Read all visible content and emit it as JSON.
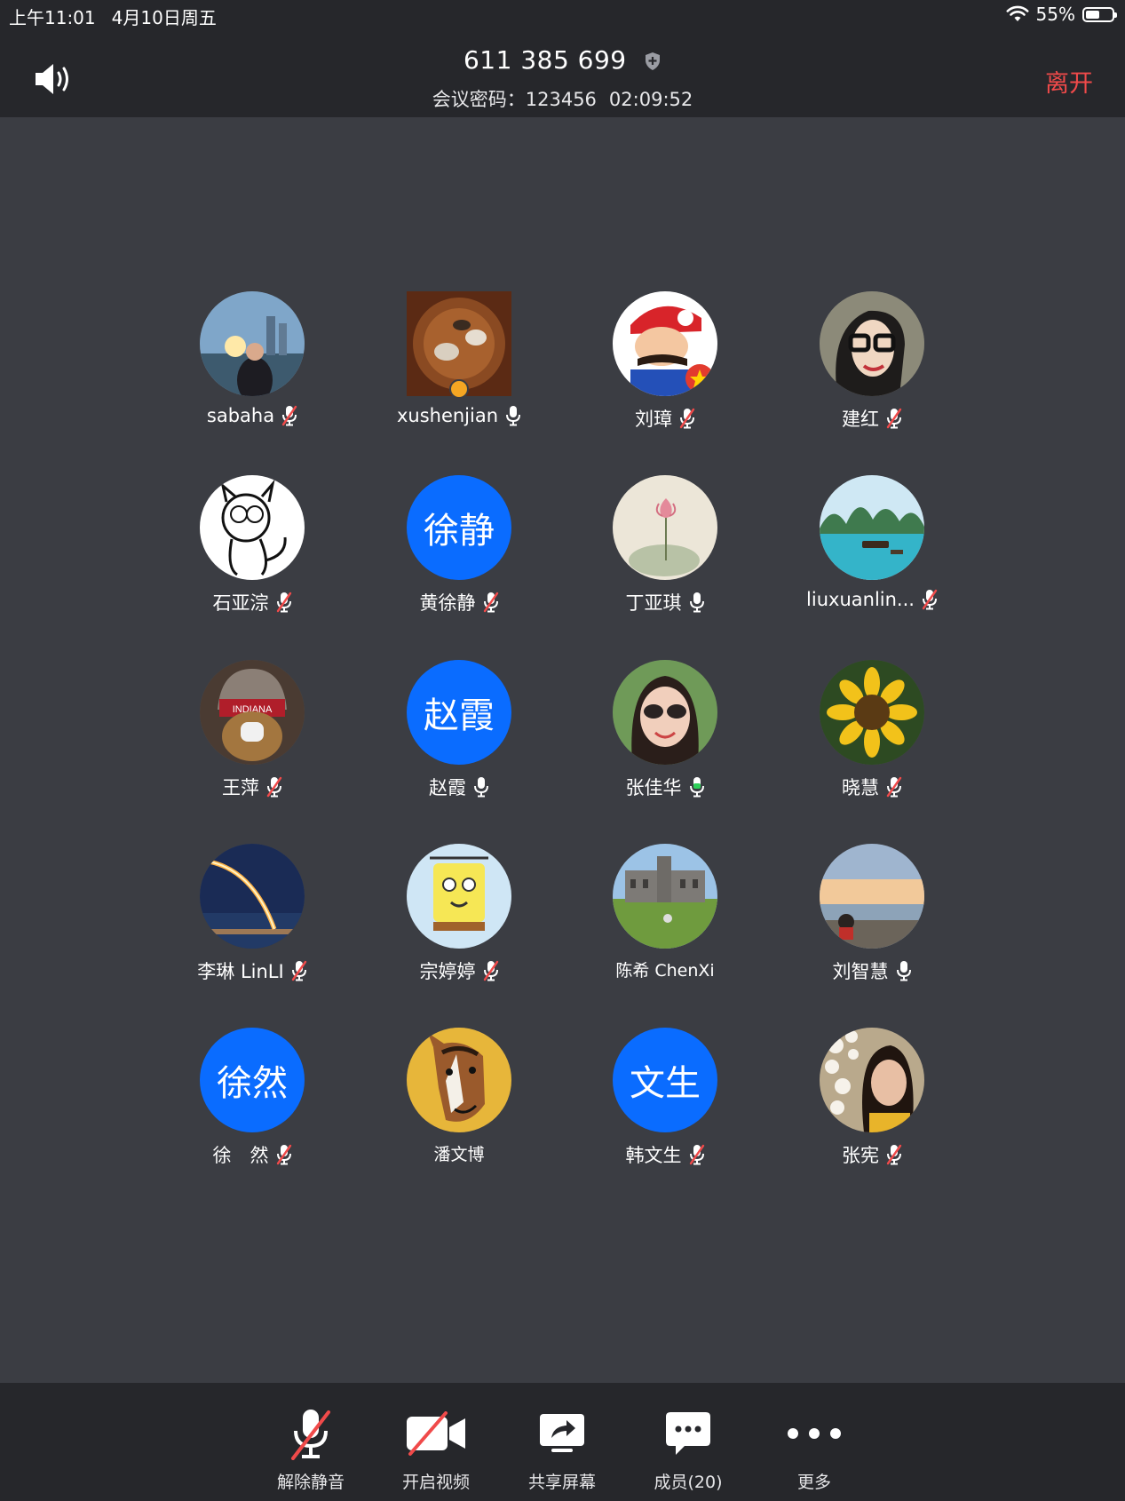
{
  "status": {
    "time": "上午11:01",
    "date": "4月10日周五",
    "battery": "55%",
    "battery_level": 0.55
  },
  "header": {
    "meeting_id": "611 385 699",
    "password_label": "会议密码：123456",
    "elapsed": "02:09:52",
    "leave_label": "离开"
  },
  "participants": [
    {
      "name": "sabaha",
      "avatar": "photo-sunset-city",
      "mic": "muted"
    },
    {
      "name": "xushenjian",
      "avatar": "photo-tea-table",
      "mic": "on",
      "host": true
    },
    {
      "name": "刘璋",
      "avatar": "cartoon-mario",
      "mic": "muted"
    },
    {
      "name": "建红",
      "avatar": "drawing-glasses-woman",
      "mic": "muted"
    },
    {
      "name": "石亚淙",
      "avatar": "sketch-cat",
      "mic": "muted"
    },
    {
      "name": "黄徐静",
      "avatar_text": "徐静",
      "mic": "muted"
    },
    {
      "name": "丁亚琪",
      "avatar": "painting-lotus",
      "mic": "on"
    },
    {
      "name": "liuxuanlin...",
      "avatar": "photo-river-mountains",
      "mic": "muted"
    },
    {
      "name": "王萍",
      "avatar": "photo-teddy-bear",
      "mic": "muted"
    },
    {
      "name": "赵霞",
      "avatar_text": "赵霞",
      "mic": "on"
    },
    {
      "name": "张佳华",
      "avatar": "photo-sunglasses-woman",
      "mic": "speaking"
    },
    {
      "name": "晓慧",
      "avatar": "photo-sunflower",
      "mic": "muted"
    },
    {
      "name": "李琳 LinLI",
      "avatar": "photo-rocket-launch",
      "mic": "muted"
    },
    {
      "name": "宗婷婷",
      "avatar": "cartoon-spongebob",
      "mic": "muted"
    },
    {
      "name": "陈希 ChenXi",
      "avatar": "photo-campus",
      "mic": "none"
    },
    {
      "name": "刘智慧",
      "avatar": "photo-beach-sunset",
      "mic": "on"
    },
    {
      "name": "徐　然",
      "avatar_text": "徐然",
      "mic": "muted"
    },
    {
      "name": "潘文博",
      "avatar": "cartoon-horse",
      "mic": "none"
    },
    {
      "name": "韩文生",
      "avatar_text": "文生",
      "mic": "muted"
    },
    {
      "name": "张宪",
      "avatar": "photo-flowers-woman",
      "mic": "muted"
    }
  ],
  "toolbar": {
    "unmute": "解除静音",
    "video": "开启视频",
    "share": "共享屏幕",
    "members": "成员(20)",
    "more": "更多"
  },
  "colors": {
    "background": "#3b3d43",
    "bar": "#26272b",
    "leave": "#f04a4a",
    "avatar_blue": "#0a6cff",
    "speaking_green": "#2fd05a",
    "mute_red": "#f04a4a"
  }
}
